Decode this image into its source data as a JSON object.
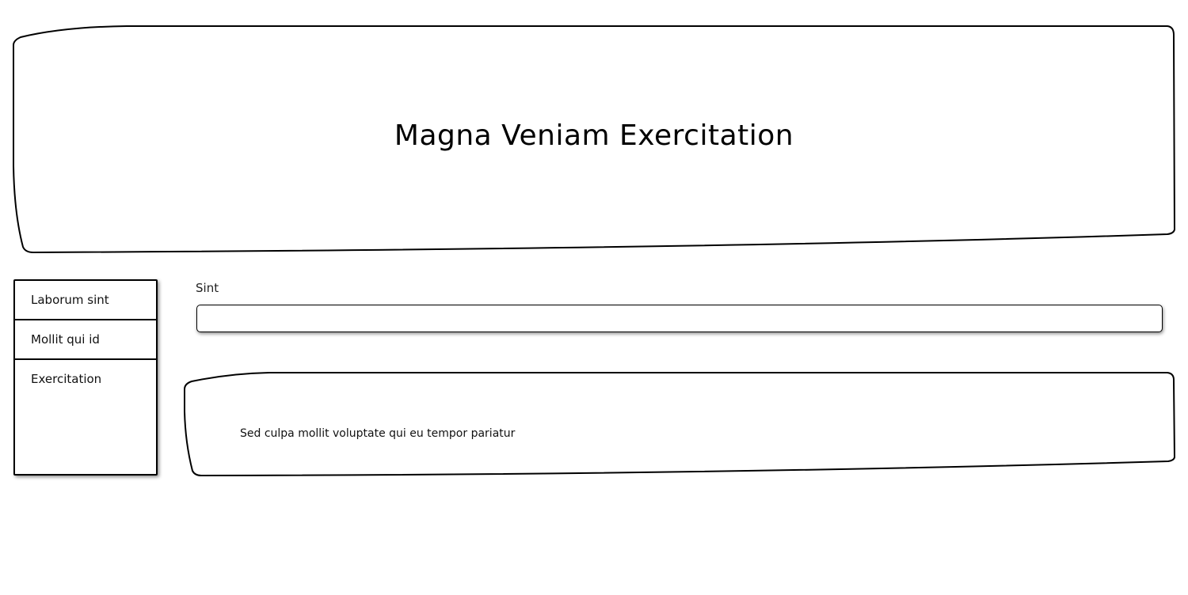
{
  "header": {
    "title": "Magna Veniam Exercitation"
  },
  "sidebar": {
    "items": [
      {
        "label": "Laborum sint"
      },
      {
        "label": "Mollit qui id"
      },
      {
        "label": "Exercitation"
      }
    ]
  },
  "form": {
    "field_label": "Sint",
    "field_value": ""
  },
  "content": {
    "text": "Sed culpa mollit voluptate qui eu tempor pariatur"
  }
}
